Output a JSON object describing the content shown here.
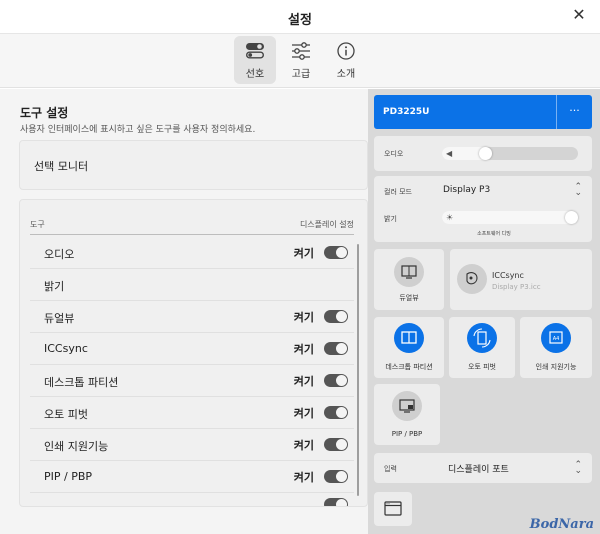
{
  "window": {
    "title": "설정"
  },
  "tabs": [
    {
      "label": "선호",
      "icon": "toggles-icon",
      "active": true
    },
    {
      "label": "고급",
      "icon": "sliders-icon",
      "active": false
    },
    {
      "label": "소개",
      "icon": "info-icon",
      "active": false
    }
  ],
  "tools_section": {
    "title": "도구 설정",
    "description": "사용자 인터페이스에 표시하고 싶은 도구를 사용자 정의하세요.",
    "monitor_select_label": "선택 모니터",
    "column_tool": "도구",
    "column_display": "디스플레이 설정",
    "rows": [
      {
        "name": "오디오",
        "state": "켜기",
        "on": true
      },
      {
        "name": "밝기",
        "state": "",
        "on": false
      },
      {
        "name": "듀얼뷰",
        "state": "켜기",
        "on": true
      },
      {
        "name": "ICCsync",
        "state": "켜기",
        "on": true
      },
      {
        "name": "데스크톱 파티션",
        "state": "켜기",
        "on": true
      },
      {
        "name": "오토 피벗",
        "state": "켜기",
        "on": true
      },
      {
        "name": "인쇄 지원기능",
        "state": "켜기",
        "on": true
      },
      {
        "name": "PIP / PBP",
        "state": "켜기",
        "on": true
      }
    ]
  },
  "preview": {
    "monitor_name": "PD3225U",
    "more": "···",
    "audio_label": "오디오",
    "audio_level": 0.3,
    "color_mode_label": "컬러 모드",
    "color_mode_value": "Display P3",
    "brightness_label": "밝기",
    "brightness_level": 1.0,
    "brightness_sublabel": "소프트웨어 디밍",
    "dualview_label": "듀얼뷰",
    "iccsync_title": "ICCsync",
    "iccsync_sub": "Display P3.icc",
    "desktop_partition_label": "데스크톱 파티션",
    "auto_pivot_label": "오토 피벗",
    "print_assist_label": "인쇄 지원기능",
    "pip_pbp_label": "PIP / PBP",
    "input_label": "입력",
    "input_value": "디스플레이 포트",
    "accent_color": "#0b72e7"
  },
  "watermark": "BodNara"
}
